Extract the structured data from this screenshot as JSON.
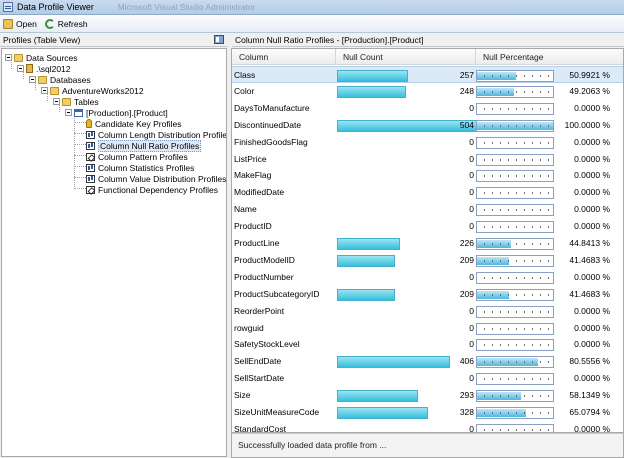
{
  "window": {
    "title": "Data Profile Viewer",
    "ghost_title": "Microsoft Visual Studio Administrator"
  },
  "toolbar": {
    "open_label": "Open",
    "refresh_label": "Refresh"
  },
  "left_pane": {
    "header": "Profiles (Table View)"
  },
  "tree": {
    "root": "Data Sources",
    "server": ".\\sql2012",
    "databases": "Databases",
    "database": "AdventureWorks2012",
    "tables": "Tables",
    "table": "[Production].[Product]",
    "profiles": [
      "Candidate Key Profiles",
      "Column Length Distribution Profiles",
      "Column Null Ratio Profiles",
      "Column Pattern Profiles",
      "Column Statistics Profiles",
      "Column Value Distribution Profiles",
      "Functional Dependency Profiles"
    ]
  },
  "right_pane": {
    "header": "Column Null Ratio Profiles  -  [Production].[Product]"
  },
  "grid": {
    "columns": [
      "Column",
      "Null Count",
      "Null Percentage"
    ],
    "max_count": 504,
    "rows": [
      {
        "name": "Class",
        "count": "257",
        "n": 257,
        "pct": "50.9921 %",
        "p": 0.509921
      },
      {
        "name": "Color",
        "count": "248",
        "n": 248,
        "pct": "49.2063 %",
        "p": 0.492063
      },
      {
        "name": "DaysToManufacture",
        "count": "0",
        "n": 0,
        "pct": "0.0000 %",
        "p": 0
      },
      {
        "name": "DiscontinuedDate",
        "count": "504",
        "n": 504,
        "pct": "100.0000 %",
        "p": 1.0
      },
      {
        "name": "FinishedGoodsFlag",
        "count": "0",
        "n": 0,
        "pct": "0.0000 %",
        "p": 0
      },
      {
        "name": "ListPrice",
        "count": "0",
        "n": 0,
        "pct": "0.0000 %",
        "p": 0
      },
      {
        "name": "MakeFlag",
        "count": "0",
        "n": 0,
        "pct": "0.0000 %",
        "p": 0
      },
      {
        "name": "ModifiedDate",
        "count": "0",
        "n": 0,
        "pct": "0.0000 %",
        "p": 0
      },
      {
        "name": "Name",
        "count": "0",
        "n": 0,
        "pct": "0.0000 %",
        "p": 0
      },
      {
        "name": "ProductID",
        "count": "0",
        "n": 0,
        "pct": "0.0000 %",
        "p": 0
      },
      {
        "name": "ProductLine",
        "count": "226",
        "n": 226,
        "pct": "44.8413 %",
        "p": 0.448413
      },
      {
        "name": "ProductModelID",
        "count": "209",
        "n": 209,
        "pct": "41.4683 %",
        "p": 0.414683
      },
      {
        "name": "ProductNumber",
        "count": "0",
        "n": 0,
        "pct": "0.0000 %",
        "p": 0
      },
      {
        "name": "ProductSubcategoryID",
        "count": "209",
        "n": 209,
        "pct": "41.4683 %",
        "p": 0.414683
      },
      {
        "name": "ReorderPoint",
        "count": "0",
        "n": 0,
        "pct": "0.0000 %",
        "p": 0
      },
      {
        "name": "rowguid",
        "count": "0",
        "n": 0,
        "pct": "0.0000 %",
        "p": 0
      },
      {
        "name": "SafetyStockLevel",
        "count": "0",
        "n": 0,
        "pct": "0.0000 %",
        "p": 0
      },
      {
        "name": "SellEndDate",
        "count": "406",
        "n": 406,
        "pct": "80.5556 %",
        "p": 0.805556
      },
      {
        "name": "SellStartDate",
        "count": "0",
        "n": 0,
        "pct": "0.0000 %",
        "p": 0
      },
      {
        "name": "Size",
        "count": "293",
        "n": 293,
        "pct": "58.1349 %",
        "p": 0.581349
      },
      {
        "name": "SizeUnitMeasureCode",
        "count": "328",
        "n": 328,
        "pct": "65.0794 %",
        "p": 0.650794
      },
      {
        "name": "StandardCost",
        "count": "0",
        "n": 0,
        "pct": "0.0000 %",
        "p": 0
      }
    ]
  },
  "status": {
    "text": "Successfully loaded data profile from  ..."
  }
}
